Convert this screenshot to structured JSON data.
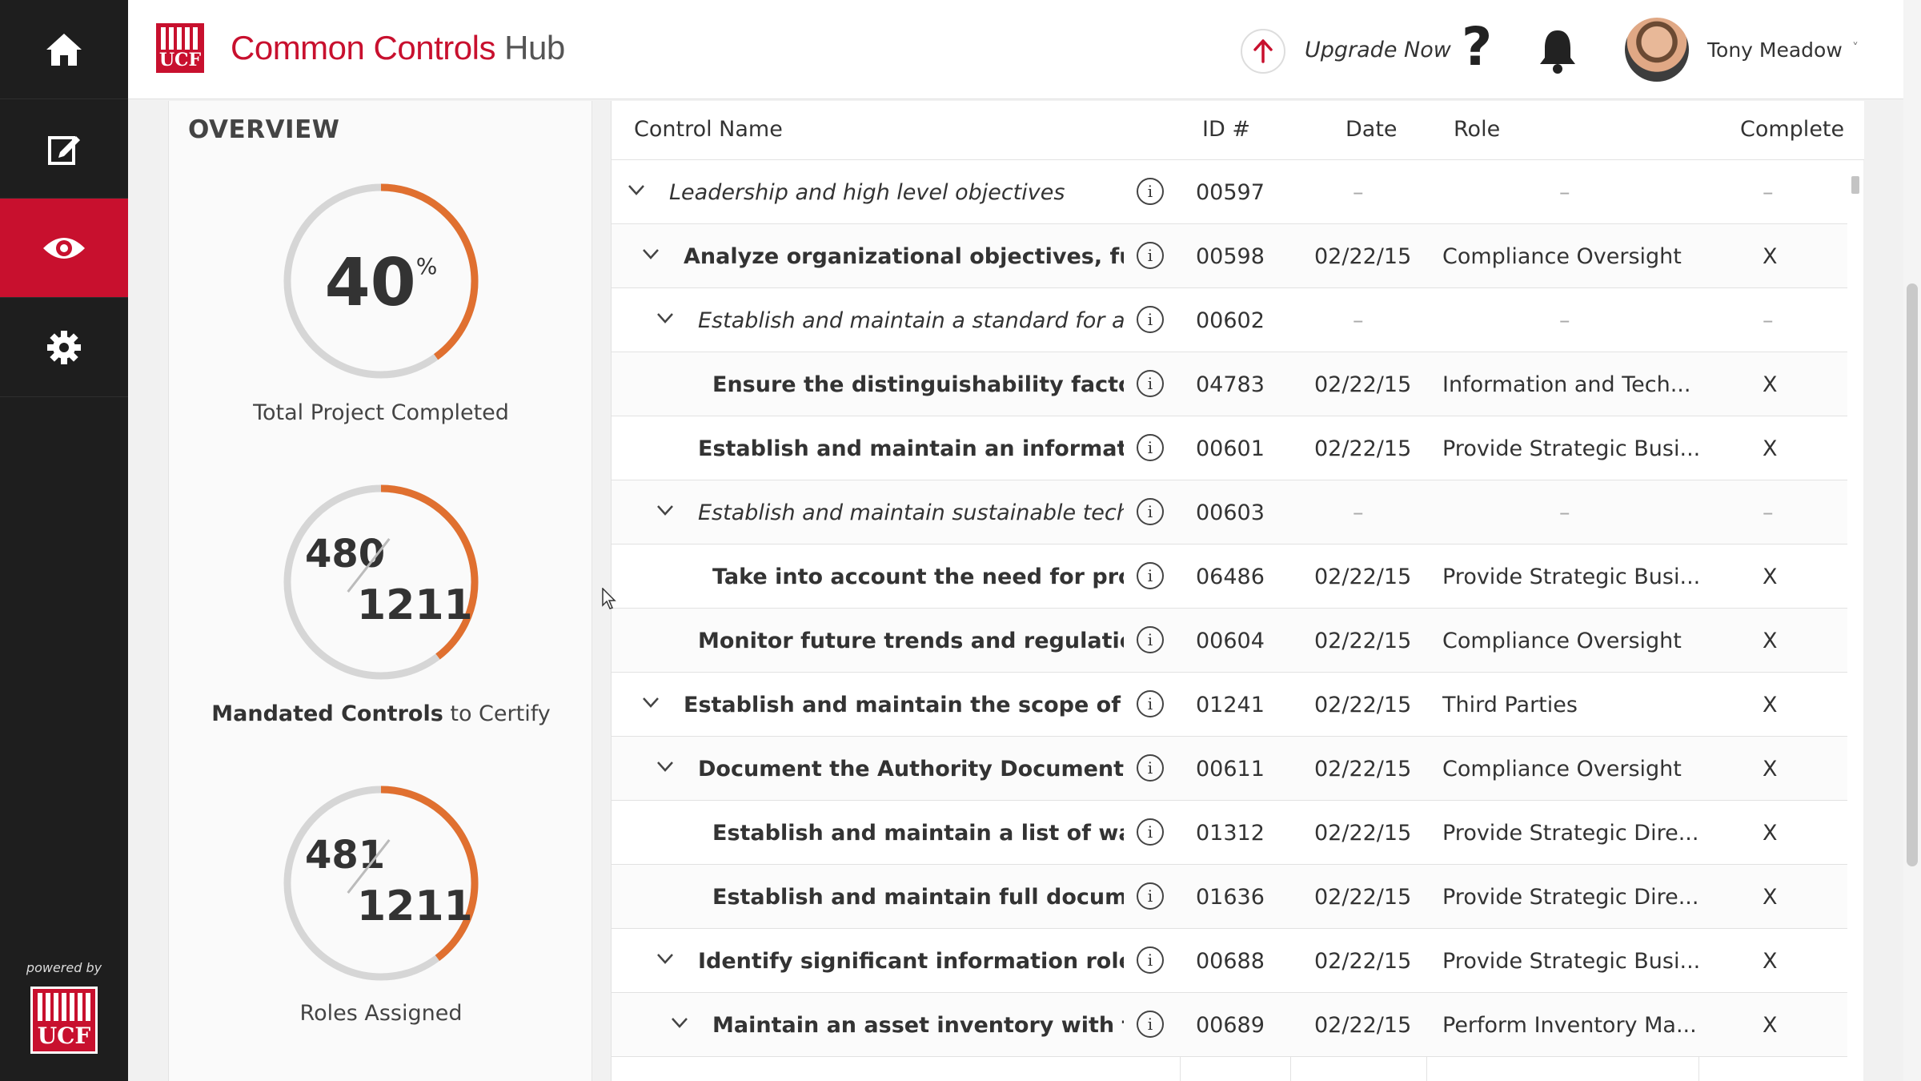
{
  "app": {
    "title_main": "Common Controls",
    "title_hub": "Hub",
    "logo_text": "UCF"
  },
  "sidebar": {
    "items": [
      {
        "name": "home",
        "icon": "home-icon"
      },
      {
        "name": "edit",
        "icon": "edit-icon"
      },
      {
        "name": "view",
        "icon": "eye-icon",
        "active": true
      },
      {
        "name": "settings",
        "icon": "gear-icon"
      }
    ],
    "powered_by": "powered by",
    "accent": "#c8102e"
  },
  "header": {
    "upgrade_label": "Upgrade Now",
    "help_glyph": "?",
    "user_name": "Tony Meadow",
    "caret": "˅"
  },
  "overview": {
    "title": "OVERVIEW",
    "rings": [
      {
        "type": "percent",
        "value": "40",
        "unit": "%",
        "fraction": 0.4,
        "caption": "Total Project Completed"
      },
      {
        "type": "fraction",
        "top": "480",
        "bottom": "1211",
        "fraction": 0.396,
        "caption_bold": "Mandated Controls",
        "caption_rest": " to Certify"
      },
      {
        "type": "fraction",
        "top": "481",
        "bottom": "1211",
        "fraction": 0.397,
        "caption": "Roles Assigned"
      }
    ],
    "ring_color": "#e07030",
    "ring_track": "#d6d6d6"
  },
  "table": {
    "headers": {
      "name": "Control Name",
      "id": "ID #",
      "date": "Date",
      "role": "Role",
      "complete": "Complete"
    },
    "rows": [
      {
        "name": "Leadership and high level objectives",
        "style": "ital",
        "level": 0,
        "expand": true,
        "id": "00597",
        "date": "–",
        "role": "–",
        "complete": "–"
      },
      {
        "name": "Analyze organizational objectives, fun...",
        "style": "bold",
        "level": 1,
        "expand": true,
        "id": "00598",
        "date": "02/22/15",
        "role": "Compliance Oversight",
        "complete": "X"
      },
      {
        "name": "Establish and maintain a standard for as...",
        "style": "ital",
        "level": 2,
        "expand": true,
        "id": "00602",
        "date": "–",
        "role": "–",
        "complete": "–"
      },
      {
        "name": "Ensure the distinguishability facto...",
        "style": "bold",
        "level": 3,
        "expand": false,
        "id": "04783",
        "date": "02/22/15",
        "role": "Information and Tech...",
        "complete": "X"
      },
      {
        "name": "Establish and maintain an informati...",
        "style": "bold",
        "level": 2,
        "expand": false,
        "id": "00601",
        "date": "02/22/15",
        "role": "Provide Strategic Busi...",
        "complete": "X"
      },
      {
        "name": "Establish and maintain sustainable techn...",
        "style": "ital",
        "level": 2,
        "expand": true,
        "id": "00603",
        "date": "–",
        "role": "–",
        "complete": "–"
      },
      {
        "name": "Take into account the need for pro...",
        "style": "bold",
        "level": 3,
        "expand": false,
        "id": "06486",
        "date": "02/22/15",
        "role": "Provide Strategic Busi...",
        "complete": "X"
      },
      {
        "name": "Monitor future trends and regulatio...",
        "style": "bold",
        "level": 2,
        "expand": false,
        "id": "00604",
        "date": "02/22/15",
        "role": "Compliance Oversight",
        "complete": "X"
      },
      {
        "name": "Establish and maintain the scope of t...",
        "style": "bold",
        "level": 1,
        "expand": true,
        "id": "01241",
        "date": "02/22/15",
        "role": "Third Parties",
        "complete": "X"
      },
      {
        "name": "Document the Authority Documents...",
        "style": "bold",
        "level": 2,
        "expand": true,
        "id": "00611",
        "date": "02/22/15",
        "role": "Compliance Oversight",
        "complete": "X"
      },
      {
        "name": "Establish and maintain a list of wa...",
        "style": "bold",
        "level": 3,
        "expand": false,
        "id": "01312",
        "date": "02/22/15",
        "role": "Provide Strategic Dire...",
        "complete": "X"
      },
      {
        "name": "Establish and maintain full docum...",
        "style": "bold",
        "level": 3,
        "expand": false,
        "id": "01636",
        "date": "02/22/15",
        "role": "Provide Strategic Dire...",
        "complete": "X"
      },
      {
        "name": "Identify significant information role...",
        "style": "bold",
        "level": 2,
        "expand": true,
        "id": "00688",
        "date": "02/22/15",
        "role": "Provide Strategic Busi...",
        "complete": "X"
      },
      {
        "name": "Maintain an asset inventory with t...",
        "style": "bold",
        "level": 3,
        "expand": true,
        "id": "00689",
        "date": "02/22/15",
        "role": "Perform Inventory Ma...",
        "complete": "X"
      }
    ]
  }
}
